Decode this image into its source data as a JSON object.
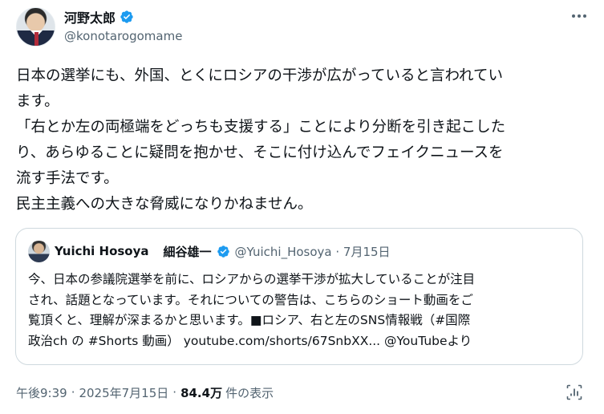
{
  "author": {
    "display_name": "河野太郎",
    "handle": "@konotarogomame",
    "verified_color": "#1d9bf0"
  },
  "icons": {
    "more": "more-horizontal-icon",
    "verified": "verified-badge-icon",
    "stats": "post-analytics-icon"
  },
  "tweet": {
    "lines": [
      "日本の選挙にも、外国、とくにロシアの干渉が広がっていると言われてい",
      "ます。",
      "「右とか左の両極端をどっちも支援する」ことにより分断を引き起こした",
      "り、あらゆることに疑問を抱かせ、そこに付け込んでフェイクニュースを",
      "流す手法です。",
      "民主主義への大きな脅威になりかねません。"
    ]
  },
  "quote": {
    "name_en": "Yuichi Hosoya",
    "name_jp": "細谷雄一",
    "handle_date": "@Yuichi_Hosoya · 7月15日",
    "lines": [
      "今、日本の参議院選挙を前に、ロシアからの選挙干渉が拡大していることが注目",
      "され、話題となっています。それについての警告は、こちらのショート動画をご",
      "覧頂くと、理解が深まるかと思います。■ロシア、右と左のSNS情報戦（#国際",
      "政治ch の #Shorts 動画） youtube.com/shorts/67SnbXX... @YouTubeより"
    ]
  },
  "meta": {
    "time": "午後9:39",
    "date": "2025年7月15日",
    "separator": "·",
    "views_count": "84.4万",
    "views_label": "件の表示"
  }
}
